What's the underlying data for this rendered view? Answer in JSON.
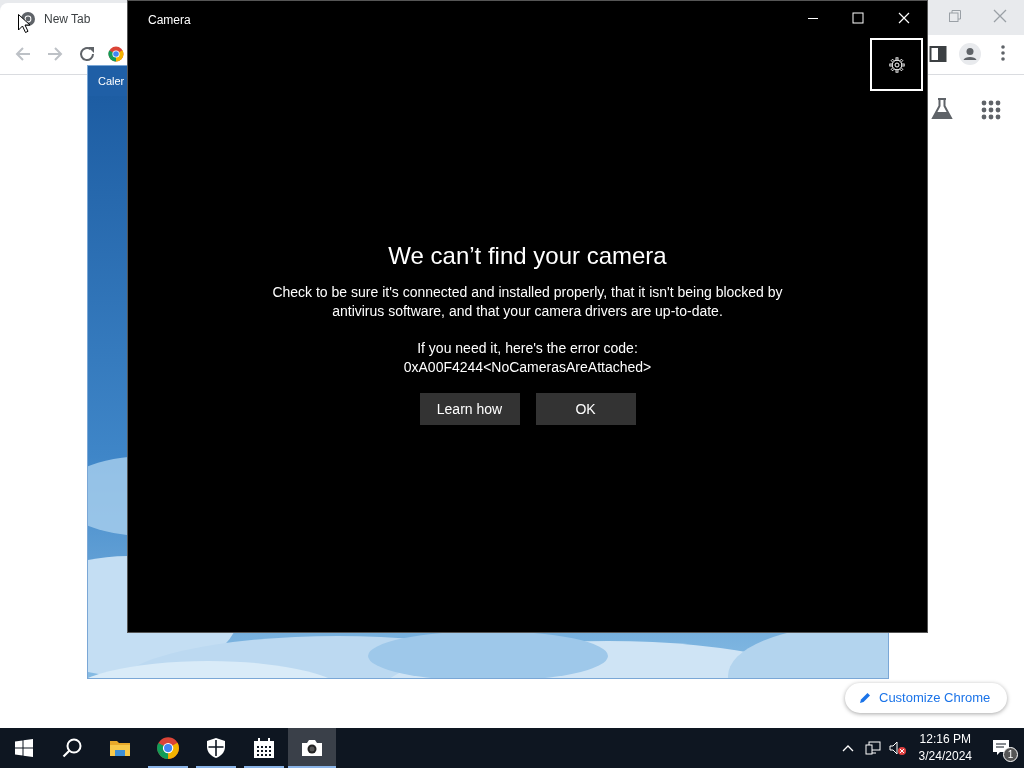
{
  "chrome": {
    "tab": {
      "title": "New Tab"
    },
    "customize_button": "Customize Chrome"
  },
  "calendar_window": {
    "title": "Caler"
  },
  "camera_window": {
    "title": "Camera",
    "heading": "We can’t find your camera",
    "message": "Check to be sure it's connected and installed properly, that it isn't being blocked by antivirus software, and that your camera drivers are up-to-date.",
    "error_intro": "If you need it, here's the error code:",
    "error_code": "0xA00F4244<NoCamerasAreAttached>",
    "buttons": [
      "Learn how",
      "OK"
    ]
  },
  "taskbar": {
    "apps": [
      {
        "kind": "explorer",
        "running": false,
        "selected": false
      },
      {
        "kind": "chrome",
        "running": true,
        "selected": false
      },
      {
        "kind": "security",
        "running": true,
        "selected": false
      },
      {
        "kind": "calendar",
        "running": true,
        "selected": false
      },
      {
        "kind": "camera",
        "running": true,
        "selected": true
      }
    ],
    "clock": {
      "time": "12:16 PM",
      "date": "3/24/2024"
    },
    "notification_count": "1"
  }
}
